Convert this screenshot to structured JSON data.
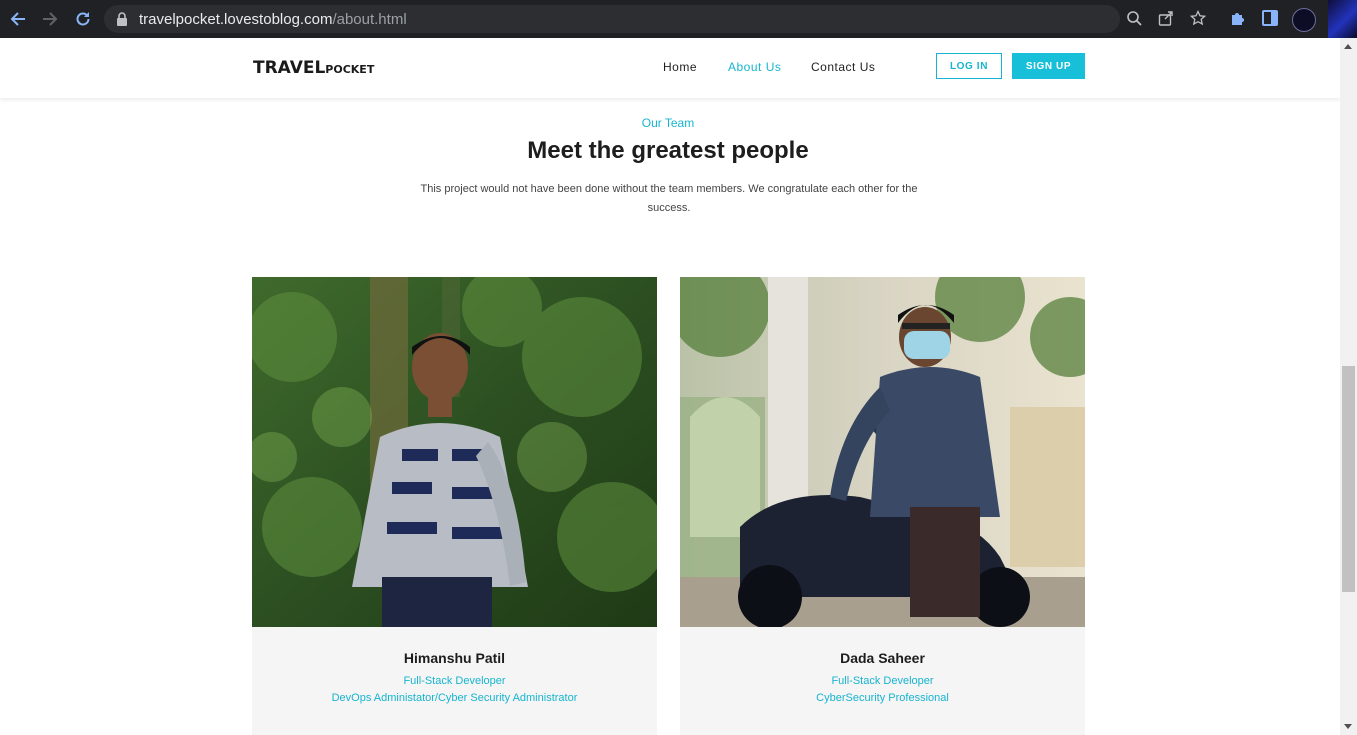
{
  "browser": {
    "url_host": "travelpocket.lovestoblog.com",
    "url_path": "/about.html"
  },
  "header": {
    "logo_main": "TRAVEL",
    "logo_sub": "POCKET",
    "nav": [
      "Home",
      "About Us",
      "Contact Us"
    ],
    "active_nav": "About Us",
    "login_label": "LOG IN",
    "signup_label": "SIGN UP"
  },
  "team": {
    "eyebrow": "Our Team",
    "title": "Meet the greatest people",
    "description": "This project would not have been done without the team members. We congratulate each other for the success.",
    "members": [
      {
        "name": "Himanshu Patil",
        "role_1": "Full-Stack Developer",
        "role_2": "DevOps Administator/Cyber Security Administrator"
      },
      {
        "name": "Dada Saheer",
        "role_1": "Full-Stack Developer",
        "role_2": "CyberSecurity Professional"
      }
    ]
  },
  "colors": {
    "accent": "#17b4d0",
    "chrome_bg": "#202124",
    "card_bg": "#f5f5f5"
  },
  "icons": [
    "back-arrow-icon",
    "forward-arrow-icon",
    "reload-icon",
    "lock-icon",
    "zoom-icon",
    "share-icon",
    "bookmark-star-icon",
    "extensions-puzzle-icon",
    "side-panel-icon",
    "profile-avatar-icon"
  ]
}
